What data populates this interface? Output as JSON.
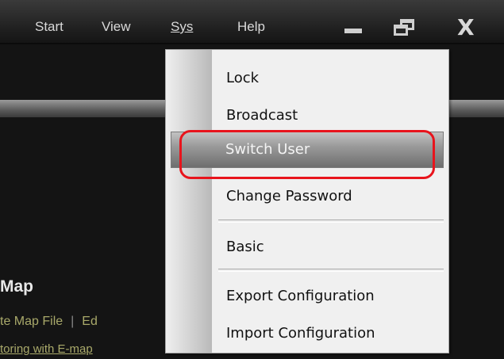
{
  "menubar": {
    "items": [
      "Start",
      "View",
      "Sys",
      "Help"
    ]
  },
  "window_controls": {
    "close_glyph": "X"
  },
  "panel": {
    "title": "Map",
    "link_create": "te Map File",
    "separator": "|",
    "link_edit": "Ed",
    "monitor_link": "toring with E-map"
  },
  "sys_menu": {
    "items": [
      "Lock",
      "Broadcast",
      "Switch User",
      "Change Password",
      "Basic",
      "Export Configuration",
      "Import Configuration"
    ],
    "highlighted": "Switch User"
  },
  "colors": {
    "highlight_ring": "#e8141c",
    "window_bg": "#141414",
    "link_text": "#a9a96a"
  }
}
